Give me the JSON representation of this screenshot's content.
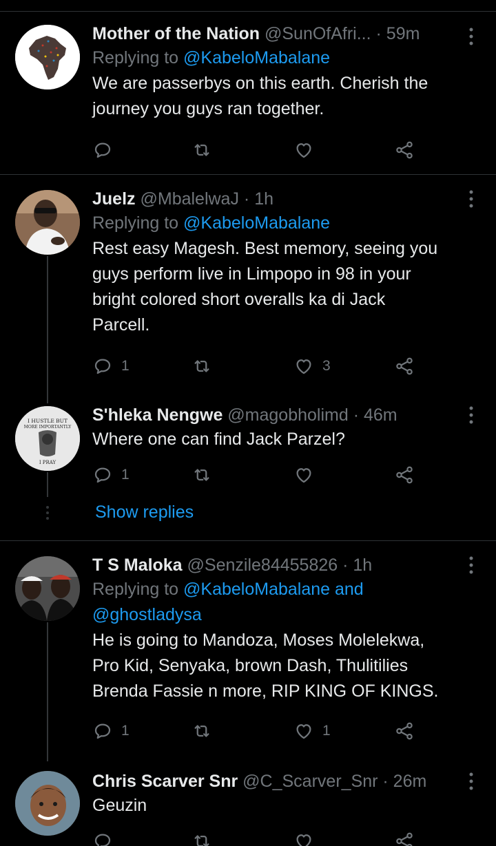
{
  "tweets": [
    {
      "name": "Mother of the Nation",
      "handle": "@SunOfAfri...",
      "time": "· 59m",
      "replying_prefix": "Replying to ",
      "replying_to": "@KabeloMabalane",
      "lines": [
        "We are passerbys on this earth. Cherish the",
        "journey you guys ran together."
      ],
      "reply_count": "",
      "like_count": ""
    },
    {
      "name": "Juelz",
      "handle": "@MbalelwaJ",
      "time": "· 1h",
      "replying_prefix": "Replying to ",
      "replying_to": "@KabeloMabalane",
      "lines": [
        "Rest easy Magesh. Best memory, seeing you",
        "guys perform live in Limpopo in 98 in your",
        "bright colored short overalls ka di Jack",
        "Parcell."
      ],
      "reply_count": "1",
      "like_count": "3"
    },
    {
      "name": "S'hleka Nengwe",
      "handle": "@magobholimd",
      "time": "· 46m",
      "lines": [
        "Where one can find Jack Parzel?"
      ],
      "reply_count": "1",
      "like_count": "",
      "avatar_text": [
        "I HUSTLE BUT",
        "MORE IMPORTANTLY",
        "I PRAY"
      ]
    },
    {
      "name": "T S Maloka",
      "handle": "@Senzile84455826",
      "time": "· 1h",
      "replying_prefix": "Replying to ",
      "replying_to": "@KabeloMabalane and",
      "replying_to_2": "@ghostladysa",
      "lines": [
        "He is going to Mandoza, Moses  Molelekwa,",
        "Pro Kid, Senyaka, brown Dash, Thulitilies",
        "Brenda Fassie n more, RIP KING OF KINGS."
      ],
      "reply_count": "1",
      "like_count": "1"
    },
    {
      "name": "Chris Scarver Snr",
      "handle": "@C_Scarver_Snr",
      "time": "· 26m",
      "lines": [
        "Geuzin"
      ],
      "reply_count": "",
      "like_count": ""
    }
  ],
  "show_replies": "Show replies",
  "icons": {
    "reply": "reply-icon",
    "retweet": "retweet-icon",
    "like": "heart-icon",
    "share": "share-icon",
    "more": "more-options-icon"
  },
  "colors": {
    "background": "#000000",
    "text": "#e7e9ea",
    "muted": "#71767b",
    "link": "#1d9bf0",
    "divider": "#2f3336"
  }
}
